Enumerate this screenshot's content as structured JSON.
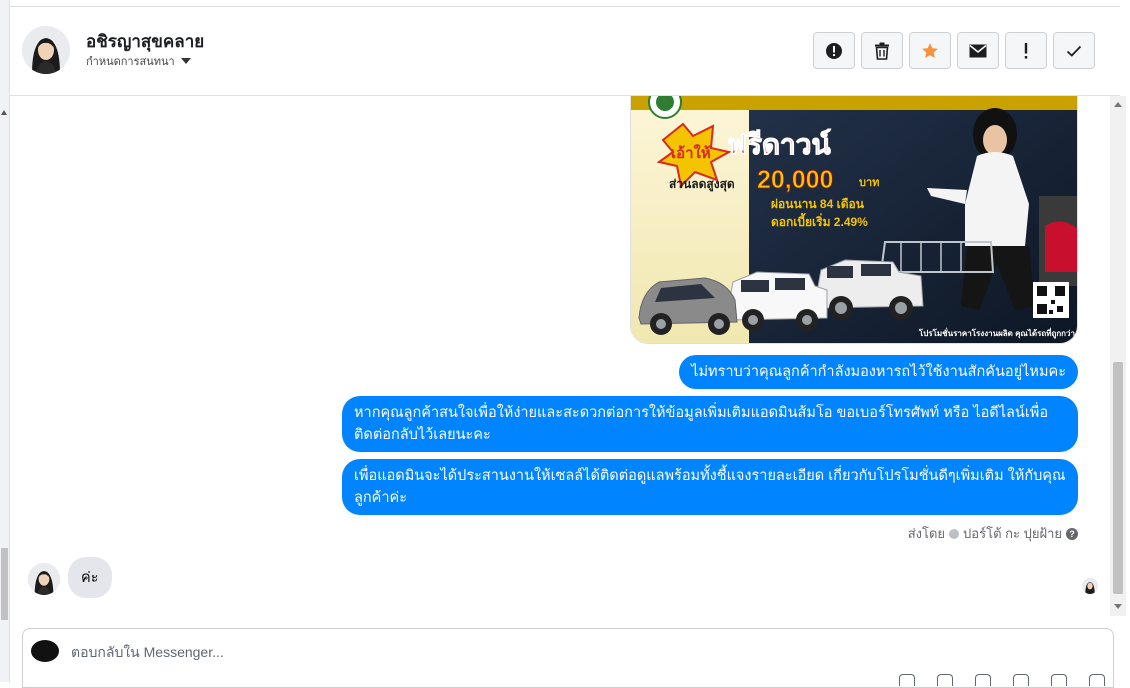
{
  "colors": {
    "messenger_blue": "#0084ff",
    "incoming_bubble": "#e4e6eb",
    "star_orange": "#f7923a"
  },
  "header": {
    "contact_name": "อชิรญาสุขคลาย",
    "assign_label": "กำหนดการสนทนา"
  },
  "toolbar": {
    "buttons": [
      {
        "icon": "alert-circle-icon",
        "name": "mark-spam-button"
      },
      {
        "icon": "trash-icon",
        "name": "delete-button"
      },
      {
        "icon": "star-icon",
        "name": "star-button"
      },
      {
        "icon": "envelope-icon",
        "name": "mark-unread-button"
      },
      {
        "icon": "exclamation-icon",
        "name": "follow-up-button"
      },
      {
        "icon": "check-icon",
        "name": "mark-done-button"
      }
    ]
  },
  "promo": {
    "headline": "ฟรีดาวน์",
    "badge": "เอ้าให้",
    "discount_label": "ส่วนลดสูงสุด",
    "discount_value": "20,000",
    "discount_unit": "บาท",
    "installment": "ผ่อนนาน 84 เดือน",
    "interest": "ดอกเบี้ยเริ่ม 2.49%",
    "footer": "โปรโมชั่นราคาโรงงานผลิต คุณได้รถที่ถูกกว่า"
  },
  "messages": {
    "outgoing": [
      "ไม่ทราบว่าคุณลูกค้ากำลังมองหารถไว้ใช้งานสักคันอยู่ไหมคะ",
      "หากคุณลูกค้าสนใจเพื่อให้ง่ายและสะดวกต่อการให้ข้อมูลเพิ่มเติมแอดมินส้มโอ ขอเบอร์โทรศัพท์ หรือ ไอดีไลน์เพื่อติดต่อกลับไว้เลยนะคะ",
      "เพื่อแอดมินจะได้ประสานงานให้เซลล์ได้ติดต่อดูแลพร้อมทั้งชี้แจงรายละเอียด เกี่ยวกับโปรโมชั่นดีๆเพิ่มเติม ให้กับคุณลูกค้าค่ะ"
    ],
    "sent_by_prefix": "ส่งโดย",
    "sent_by_name": "ปอร์โต้ กะ ปุยฝ้าย",
    "incoming": "ค่ะ"
  },
  "composer": {
    "placeholder": "ตอบกลับใน Messenger..."
  }
}
